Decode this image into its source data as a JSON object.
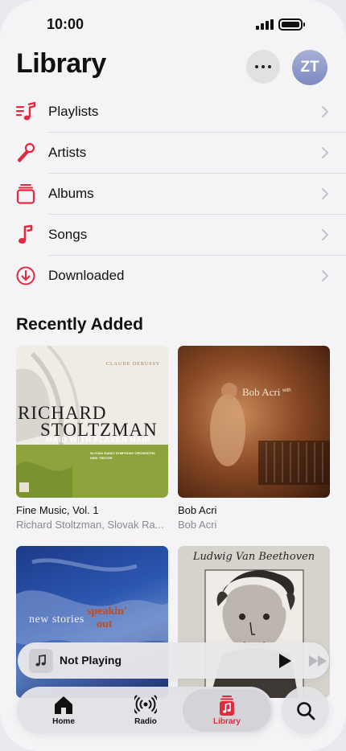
{
  "status_bar": {
    "time": "10:00"
  },
  "header": {
    "title": "Library",
    "avatar_initials": "ZT"
  },
  "nav_items": [
    {
      "label": "Playlists",
      "icon": "playlist-icon"
    },
    {
      "label": "Artists",
      "icon": "microphone-icon"
    },
    {
      "label": "Albums",
      "icon": "album-stack-icon"
    },
    {
      "label": "Songs",
      "icon": "music-note-icon"
    },
    {
      "label": "Downloaded",
      "icon": "download-circle-icon"
    }
  ],
  "recently_added": {
    "title": "Recently Added",
    "albums": [
      {
        "title": "Fine Music, Vol. 1",
        "artist": "Richard Stoltzman, Slovak Ra...",
        "cover": {
          "top_text": "CLAUDE DEBUSSY",
          "name_line1": "RICHARD",
          "name_line2": "STOLTZMAN",
          "subtitle": "MAID WITH FLAXEN HAIR",
          "credit1": "SLOVAK RADIO SYMPHONY ORCHESTRA",
          "credit2": "DIRK TREVOR"
        }
      },
      {
        "title": "Bob Acri",
        "artist": "Bob Acri",
        "cover": {
          "name": "Bob Acri",
          "suffix": "with"
        }
      },
      {
        "title": "",
        "artist": "",
        "cover": {
          "line1": "new stories",
          "line2": "speakin'",
          "line3": "out"
        }
      },
      {
        "title": "",
        "artist": "",
        "cover": {
          "script": "Ludwig Van Beethoven"
        }
      }
    ]
  },
  "mini_player": {
    "title": "Not Playing"
  },
  "tabs": [
    {
      "label": "Home",
      "icon": "home-icon"
    },
    {
      "label": "Radio",
      "icon": "radio-waves-icon"
    },
    {
      "label": "Library",
      "icon": "library-icon",
      "active": true
    }
  ],
  "colors": {
    "accent": "#e22a3e",
    "background": "#f4f4f6"
  }
}
